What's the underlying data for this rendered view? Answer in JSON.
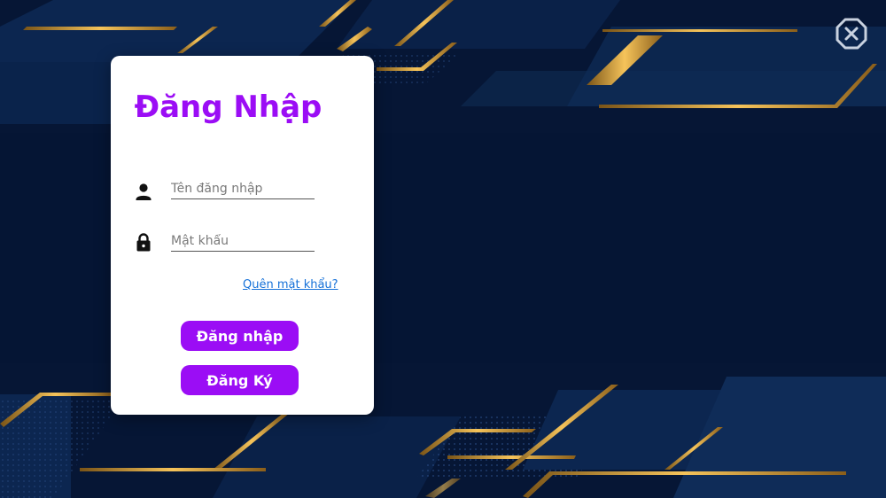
{
  "login_card": {
    "title": "Đăng Nhập",
    "username": {
      "value": "",
      "placeholder": "Tên đăng nhập",
      "icon": "user-icon"
    },
    "password": {
      "value": "",
      "placeholder": "Mật khẩu",
      "icon": "lock-icon"
    },
    "forgot_password_label": "Quên mật khẩu?",
    "login_button_label": "Đăng nhập",
    "register_button_label": "Đăng Ký"
  },
  "window": {
    "close_icon": "close-icon"
  },
  "colors": {
    "accent": "#9b0df5",
    "link": "#1470d8",
    "background": "#071a3a",
    "gold": "#e0a83a"
  }
}
